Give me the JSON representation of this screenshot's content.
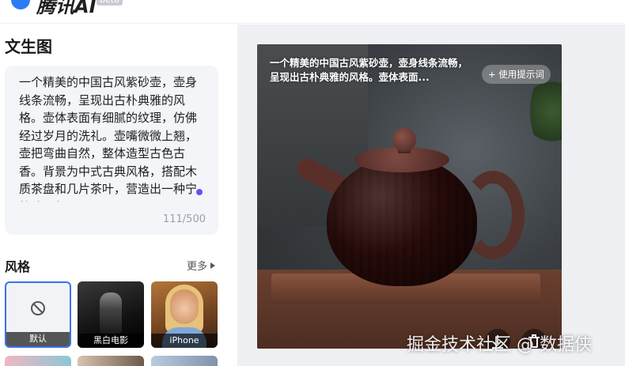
{
  "app": {
    "name": "腾讯AI",
    "badge": "beta"
  },
  "left_panel": {
    "title": "文生图",
    "prompt": {
      "text": "一个精美的中国古风紫砂壶，壶身线条流畅，呈现出古朴典雅的风格。壶体表面有细腻的纹理，仿佛经过岁月的洗礼。壶嘴微微上翘，壶把弯曲自然，整体造型古色古香。背景为中式古典风格，搭配木质茶盘和几片茶叶，营造出一种宁静致远氛围。",
      "counter": "111/500"
    },
    "styles": {
      "label": "风格",
      "more_label": "更多",
      "items": [
        {
          "label": "默认",
          "selected": true
        },
        {
          "label": "黑白电影",
          "selected": false
        },
        {
          "label": "iPhone",
          "selected": false
        }
      ]
    }
  },
  "result": {
    "caption": "一个精美的中国古风紫砂壶，壶身线条流畅，呈现出古朴典雅的风格。壶体表面...",
    "use_prompt_label": "+ 使用提示词",
    "actions": [
      "download-icon",
      "trash-icon"
    ]
  },
  "watermark": "掘金技术社区 @ 数据侠",
  "colors": {
    "accent": "#3a73e8",
    "caret": "#6b4cf5",
    "panel_bg": "#f3f5f8",
    "canvas_bg": "#eef0f4"
  }
}
